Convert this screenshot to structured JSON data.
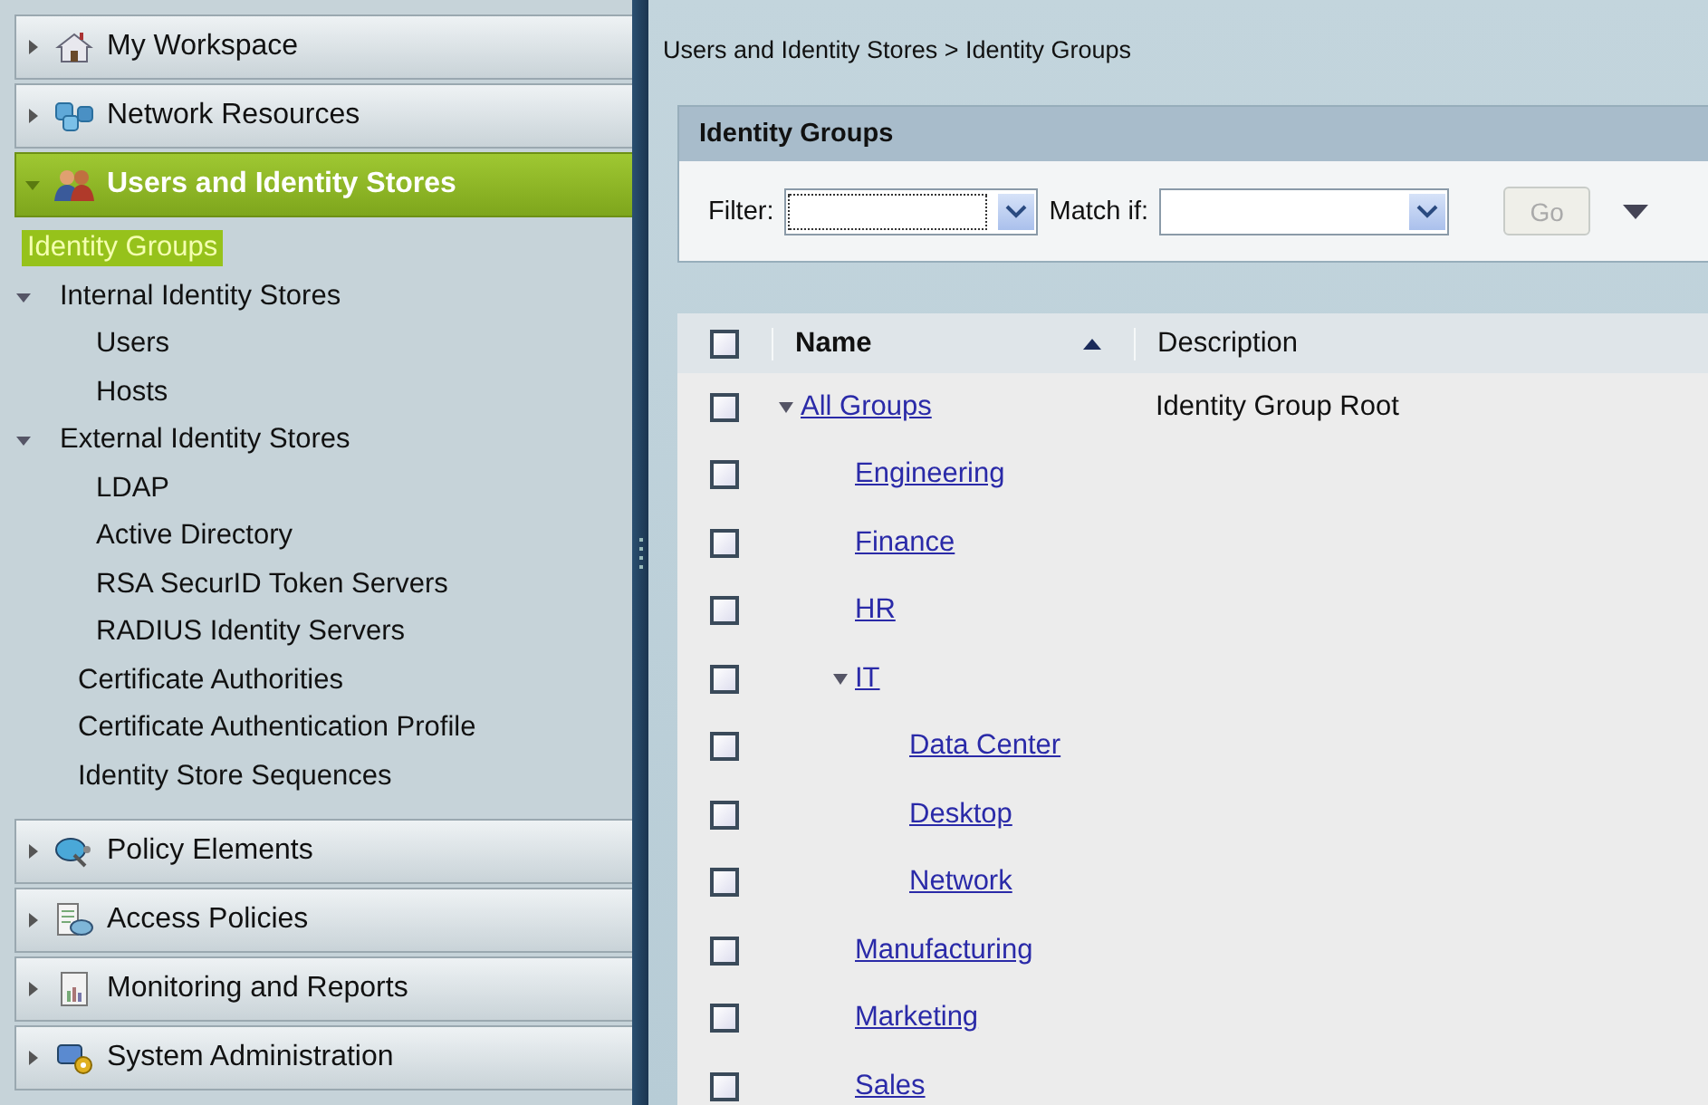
{
  "sidebar": {
    "sections": [
      {
        "label": "My Workspace",
        "expanded": false,
        "selected": false
      },
      {
        "label": "Network Resources",
        "expanded": false,
        "selected": false
      },
      {
        "label": "Users and Identity Stores",
        "expanded": true,
        "selected": true,
        "items": [
          {
            "label": "Identity Groups",
            "selected": true
          },
          {
            "label": "Internal Identity Stores",
            "selected": false,
            "expanded": true,
            "children": [
              {
                "label": "Users",
                "selected": false
              },
              {
                "label": "Hosts",
                "selected": false
              }
            ]
          },
          {
            "label": "External Identity Stores",
            "selected": false,
            "expanded": true,
            "children": [
              {
                "label": "LDAP",
                "selected": false
              },
              {
                "label": "Active Directory",
                "selected": false
              },
              {
                "label": "RSA SecurID Token Servers",
                "selected": false
              },
              {
                "label": "RADIUS Identity Servers",
                "selected": false
              }
            ]
          },
          {
            "label": "Certificate Authorities",
            "selected": false
          },
          {
            "label": "Certificate Authentication Profile",
            "selected": false
          },
          {
            "label": "Identity Store Sequences",
            "selected": false
          }
        ]
      },
      {
        "label": "Policy Elements",
        "expanded": false,
        "selected": false
      },
      {
        "label": "Access Policies",
        "expanded": false,
        "selected": false
      },
      {
        "label": "Monitoring and Reports",
        "expanded": false,
        "selected": false
      },
      {
        "label": "System Administration",
        "expanded": false,
        "selected": false
      }
    ]
  },
  "breadcrumb": "Users and Identity Stores > Identity Groups",
  "panel": {
    "title": "Identity Groups",
    "filter": {
      "label": "Filter:"
    },
    "match": {
      "label": "Match if:"
    },
    "go_button": {
      "label": "Go",
      "disabled": true
    },
    "table": {
      "columns": [
        "Name",
        "Description"
      ],
      "sort_ascending": true,
      "all_checked": false,
      "rows": [
        {
          "name": "All Groups",
          "description": "Identity Group Root",
          "checked": false,
          "expanded": true,
          "children": [
            {
              "name": "Engineering",
              "checked": false
            },
            {
              "name": "Finance",
              "checked": false
            },
            {
              "name": "HR",
              "checked": false
            },
            {
              "name": "IT",
              "checked": false,
              "expanded": true,
              "children": [
                {
                  "name": "Data Center",
                  "checked": false
                },
                {
                  "name": "Desktop",
                  "checked": false
                },
                {
                  "name": "Network",
                  "checked": false
                }
              ]
            },
            {
              "name": "Manufacturing",
              "checked": false
            },
            {
              "name": "Marketing",
              "checked": false
            },
            {
              "name": "Sales",
              "checked": false
            }
          ]
        }
      ]
    }
  }
}
